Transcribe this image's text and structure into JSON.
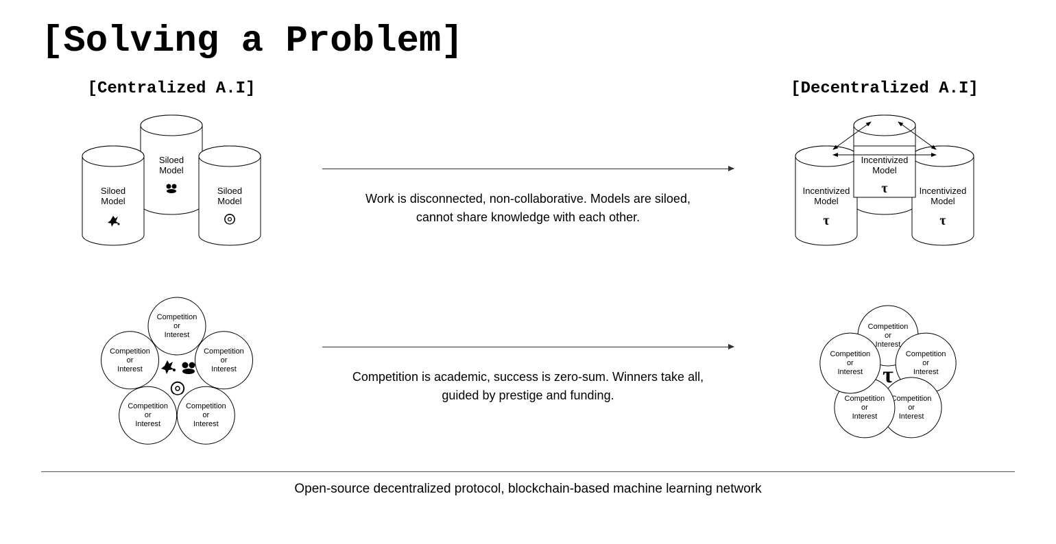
{
  "title": "[Solving a Problem]",
  "left_heading": "[Centralized A.I]",
  "right_heading": "[Decentralized A.I]",
  "row1": {
    "left_label": "Siloed\nModel",
    "right_label": "Incentivized\nModel",
    "symbol_right": "τ",
    "description": "Work is disconnected, non-collaborative. Models are siloed, cannot share knowledge with each other."
  },
  "row2": {
    "circle_label": "Competition\nor\nInterest",
    "symbol_right": "τ",
    "description": "Competition is academic, success is zero-sum. Winners take all, guided by prestige and funding."
  },
  "footer": "Open-source decentralized protocol, blockchain-based machine learning network"
}
